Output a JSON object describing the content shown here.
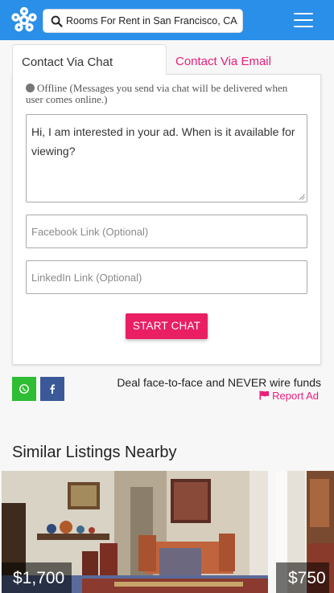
{
  "header": {
    "search_text": "Rooms For Rent in San Francisco, CA, ...",
    "brand_color": "#2a8fe8"
  },
  "tabs": {
    "chat_label": "Contact Via Chat",
    "email_label": "Contact Via Email"
  },
  "contact_form": {
    "status": "Offline (Messages you send via chat will be delivered when user comes online.)",
    "message": "Hi, I am interested in your ad. When is it available for viewing?",
    "facebook_placeholder": "Facebook Link (Optional)",
    "linkedin_placeholder": "LinkedIn Link (Optional)",
    "start_chat_label": "START CHAT",
    "accent_color": "#e91e63"
  },
  "share": {
    "whatsapp_icon": "whatsapp-icon",
    "facebook_icon": "facebook-icon"
  },
  "safety": {
    "warning": "Deal face-to-face and NEVER wire funds",
    "report_label": "Report Ad"
  },
  "similar": {
    "title": "Similar Listings Nearby",
    "listings": [
      {
        "price": "$1,700"
      },
      {
        "price": "$750"
      }
    ]
  }
}
